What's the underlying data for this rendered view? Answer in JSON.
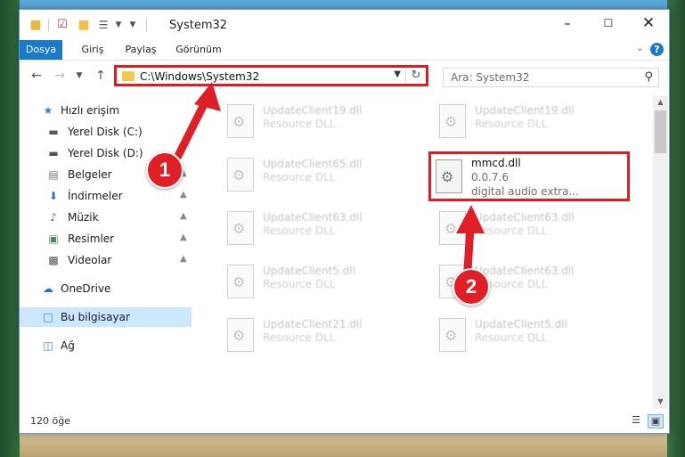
{
  "window": {
    "title": "System32"
  },
  "colors": {
    "accent": "#1979ca",
    "highlight": "#e11b22",
    "selected_nav": "#cce8ff"
  },
  "icons": {
    "quick_access_toolbar": [
      "folder-icon",
      "properties-icon",
      "new-folder-icon",
      "customize-icon"
    ],
    "window_buttons": [
      "minimize-icon",
      "maximize-icon",
      "close-icon"
    ]
  },
  "ribbon": {
    "tabs": [
      "Dosya",
      "Giriş",
      "Paylaş",
      "Görünüm"
    ],
    "help": "?"
  },
  "navigation": {
    "address": "C:\\Windows\\System32",
    "search_placeholder": "Ara: System32"
  },
  "sidebar": {
    "items": [
      {
        "label": "Hızlı erişim",
        "icon": "star-icon",
        "pinned": false
      },
      {
        "label": "Yerel Disk (C:)",
        "icon": "drive-icon",
        "pinned": false
      },
      {
        "label": "Yerel Disk (D:)",
        "icon": "drive-icon",
        "pinned": false
      },
      {
        "label": "Belgeler",
        "icon": "documents-icon",
        "pinned": true
      },
      {
        "label": "İndirmeler",
        "icon": "download-icon",
        "pinned": true
      },
      {
        "label": "Müzik",
        "icon": "music-icon",
        "pinned": true
      },
      {
        "label": "Resimler",
        "icon": "pictures-icon",
        "pinned": true
      },
      {
        "label": "Videolar",
        "icon": "video-icon",
        "pinned": true
      },
      {
        "label": "OneDrive",
        "icon": "cloud-icon",
        "pinned": false
      },
      {
        "label": "Bu bilgisayar",
        "icon": "computer-icon",
        "pinned": false
      },
      {
        "label": "Ağ",
        "icon": "network-icon",
        "pinned": false
      }
    ]
  },
  "files": [
    {
      "name": "UpdateClient19.dll",
      "desc": "Resource DLL"
    },
    {
      "name": "UpdateClient19.dll",
      "desc": "Resource DLL"
    },
    {
      "name": "UpdateClient65.dll",
      "desc": "Resource DLL"
    },
    {
      "name": "UpdateClient63.dll",
      "desc": "Resource DLL"
    },
    {
      "name": "UpdateClient63.dll",
      "desc": "Resource DLL"
    },
    {
      "name": "UpdateClient5.dll",
      "desc": "Resource DLL"
    },
    {
      "name": "UpdateClient63.dll",
      "desc": "Resource DLL"
    },
    {
      "name": "UpdateClient21.dll",
      "desc": "Resource DLL"
    },
    {
      "name": "UpdateClient5.dll",
      "desc": "Resource DLL"
    }
  ],
  "highlighted_file": {
    "name": "mmcd.dll",
    "version": "0.0.7.6",
    "description": "digital audio extra..."
  },
  "annotations": {
    "badge1": "1",
    "badge2": "2"
  },
  "status": {
    "item_count": "120 öğe"
  }
}
